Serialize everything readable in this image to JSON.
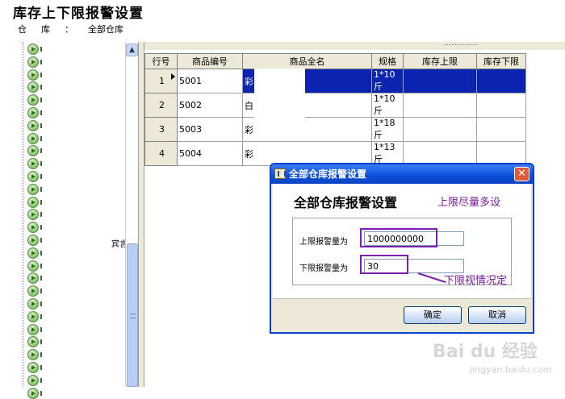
{
  "page": {
    "title": "库存上下限报警设置",
    "warehouse_label": "仓库：",
    "warehouse_value": "全部仓库"
  },
  "tree": {
    "node_count": 28,
    "side_label": "宾言"
  },
  "grid": {
    "columns": [
      "行号",
      "商品编号",
      "商品全名",
      "规格",
      "库存上限",
      "库存下限"
    ],
    "rows": [
      {
        "row": "1",
        "code": "5001",
        "name": "彩",
        "spec": "1*10斤",
        "upper": "",
        "lower": "",
        "selected": true
      },
      {
        "row": "2",
        "code": "5002",
        "name": "白",
        "spec": "1*10斤",
        "upper": "",
        "lower": "",
        "selected": false
      },
      {
        "row": "3",
        "code": "5003",
        "name": "彩",
        "spec": "1*18斤",
        "upper": "",
        "lower": "",
        "selected": false
      },
      {
        "row": "4",
        "code": "5004",
        "name": "彩",
        "spec": "1*13斤",
        "upper": "",
        "lower": "",
        "selected": false
      }
    ]
  },
  "dialog": {
    "title": "全部仓库报警设置",
    "heading": "全部仓库报警设置",
    "upper_label": "上限报警量为",
    "upper_value": "1000000000",
    "lower_label": "下限报警量为",
    "lower_value": "30",
    "ok_label": "确定",
    "cancel_label": "取消",
    "close_glyph": "✕"
  },
  "annotations": {
    "upper_note": "上限尽量多设",
    "lower_note": "下限视情况定"
  },
  "watermark": {
    "brand": "Bai du 经验",
    "url": "jingyan.baidu.com"
  },
  "colors": {
    "selection": "#0a24b0",
    "dialog_titlebar": "#0b4fd8",
    "annotation": "#7a1a9a",
    "highlight_box": "#7a1fb0"
  }
}
